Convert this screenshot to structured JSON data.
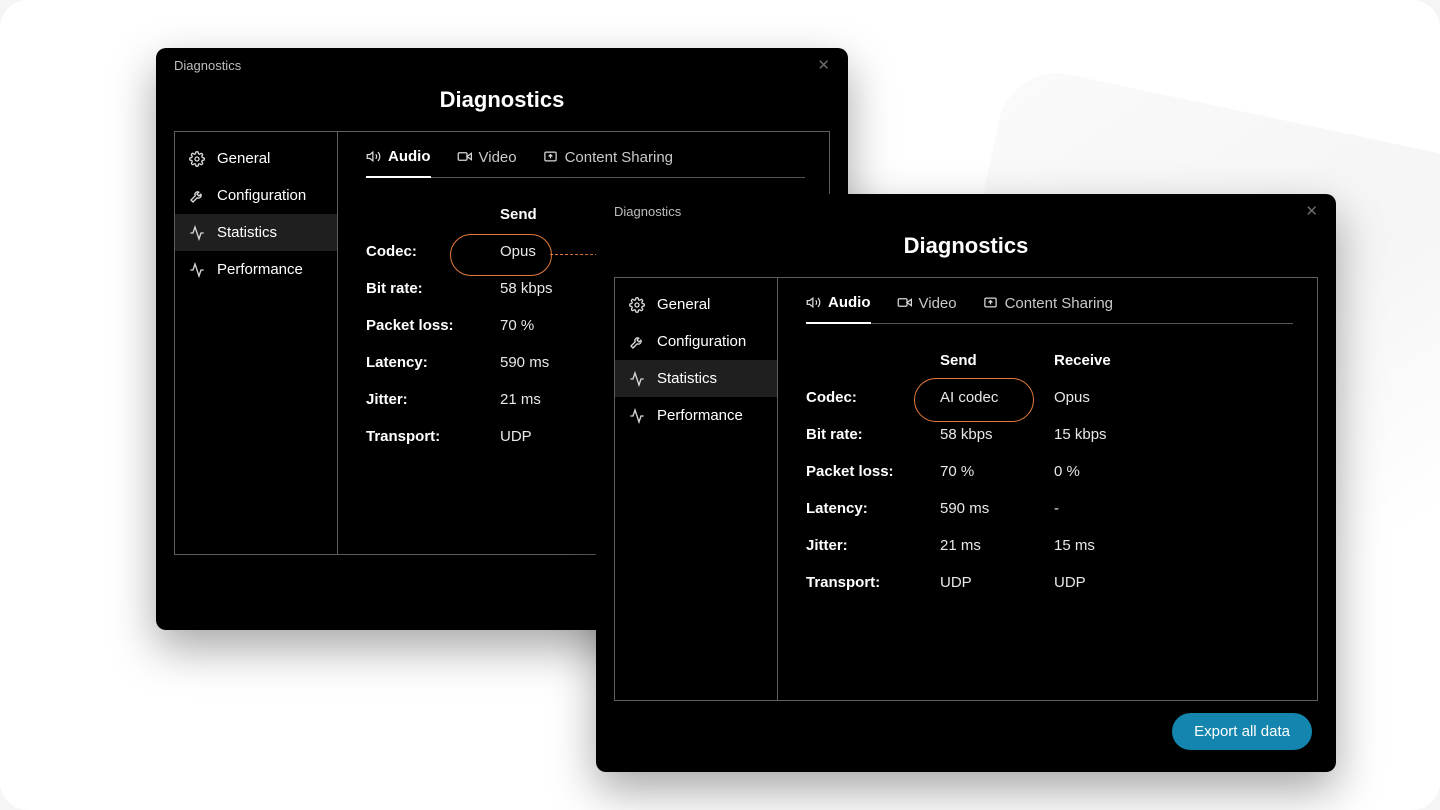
{
  "colors": {
    "accent_orange": "#e47b3d",
    "accent_blue": "#1385af"
  },
  "windows": {
    "w1": {
      "titlebar": "Diagnostics",
      "heading": "Diagnostics",
      "sidebar": [
        {
          "icon": "gear-icon",
          "label": "General"
        },
        {
          "icon": "tools-icon",
          "label": "Configuration"
        },
        {
          "icon": "activity-icon",
          "label": "Statistics",
          "active": true
        },
        {
          "icon": "activity-icon",
          "label": "Performance"
        }
      ],
      "tabs": [
        {
          "icon": "speaker-icon",
          "label": "Audio",
          "active": true
        },
        {
          "icon": "video-icon",
          "label": "Video"
        },
        {
          "icon": "share-icon",
          "label": "Content Sharing"
        }
      ],
      "columns": [
        "",
        "Send"
      ],
      "rows": [
        {
          "label": "Codec:",
          "send": "Opus",
          "highlight": true
        },
        {
          "label": "Bit rate:",
          "send": "58 kbps"
        },
        {
          "label": "Packet loss:",
          "send": "70 %"
        },
        {
          "label": "Latency:",
          "send": "590 ms"
        },
        {
          "label": "Jitter:",
          "send": "21 ms"
        },
        {
          "label": "Transport:",
          "send": "UDP"
        }
      ]
    },
    "w2": {
      "titlebar": "Diagnostics",
      "heading": "Diagnostics",
      "sidebar": [
        {
          "icon": "gear-icon",
          "label": "General"
        },
        {
          "icon": "tools-icon",
          "label": "Configuration"
        },
        {
          "icon": "activity-icon",
          "label": "Statistics",
          "active": true
        },
        {
          "icon": "activity-icon",
          "label": "Performance"
        }
      ],
      "tabs": [
        {
          "icon": "speaker-icon",
          "label": "Audio",
          "active": true
        },
        {
          "icon": "video-icon",
          "label": "Video"
        },
        {
          "icon": "share-icon",
          "label": "Content Sharing"
        }
      ],
      "columns": [
        "",
        "Send",
        "Receive"
      ],
      "rows": [
        {
          "label": "Codec:",
          "send": "AI codec",
          "receive": "Opus",
          "highlight": true
        },
        {
          "label": "Bit rate:",
          "send": "58 kbps",
          "receive": "15 kbps"
        },
        {
          "label": "Packet loss:",
          "send": "70 %",
          "receive": "0 %"
        },
        {
          "label": "Latency:",
          "send": "590 ms",
          "receive": "-"
        },
        {
          "label": "Jitter:",
          "send": "21 ms",
          "receive": "15 ms"
        },
        {
          "label": "Transport:",
          "send": "UDP",
          "receive": "UDP"
        }
      ],
      "export_label": "Export all data"
    }
  }
}
